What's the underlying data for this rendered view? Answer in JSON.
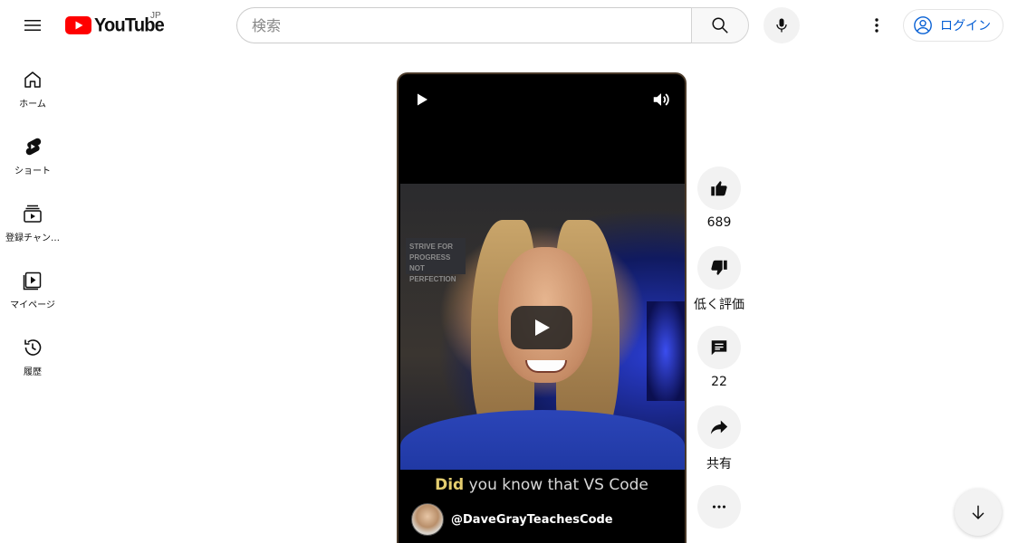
{
  "header": {
    "logo_text": "YouTube",
    "region": "JP",
    "search_placeholder": "検索",
    "signin_label": "ログイン"
  },
  "sidebar": {
    "items": [
      {
        "label": "ホーム",
        "icon": "home-icon"
      },
      {
        "label": "ショート",
        "icon": "shorts-icon"
      },
      {
        "label": "登録チャン…",
        "icon": "subscriptions-icon"
      },
      {
        "label": "マイページ",
        "icon": "library-icon"
      },
      {
        "label": "履歴",
        "icon": "history-icon"
      }
    ]
  },
  "player": {
    "caption_highlight": "Did",
    "caption_rest": " you know that VS Code",
    "channel_name": "@DaveGrayTeachesCode",
    "poster_text": "STRIVE FOR PROGRESS NOT PERFECTION"
  },
  "actions": {
    "like_count": "689",
    "dislike_label": "低く評価",
    "comment_count": "22",
    "share_label": "共有"
  },
  "colors": {
    "brand_red": "#ff0000",
    "link_blue": "#065fd4",
    "caption_highlight": "#e4cd6f"
  }
}
